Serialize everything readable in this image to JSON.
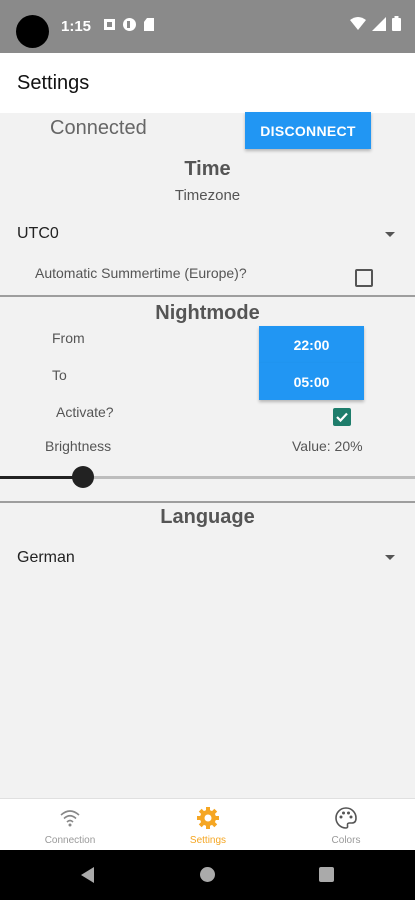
{
  "status_bar": {
    "time": "1:15"
  },
  "app_bar": {
    "title": "Settings"
  },
  "connection": {
    "status": "Connected",
    "button_label": "DISCONNECT"
  },
  "time_section": {
    "title": "Time",
    "timezone_label": "Timezone",
    "timezone_value": "UTC0",
    "summertime_label": "Automatic Summertime (Europe)?",
    "summertime_checked": false
  },
  "nightmode": {
    "title": "Nightmode",
    "from_label": "From",
    "from_value": "22:00",
    "to_label": "To",
    "to_value": "05:00",
    "activate_label": "Activate?",
    "activate_checked": true,
    "brightness_label": "Brightness",
    "brightness_value_text": "Value: 20%",
    "brightness_fraction": 0.2
  },
  "language": {
    "title": "Language",
    "value": "German"
  },
  "bottom_nav": {
    "items": [
      {
        "label": "Connection",
        "icon": "wifi-icon",
        "active": false
      },
      {
        "label": "Settings",
        "icon": "gear-icon",
        "active": true
      },
      {
        "label": "Colors",
        "icon": "palette-icon",
        "active": false
      }
    ]
  },
  "colors": {
    "accent": "#2196f3",
    "active_nav": "#f5a623",
    "checkbox": "#1e7d6b"
  }
}
